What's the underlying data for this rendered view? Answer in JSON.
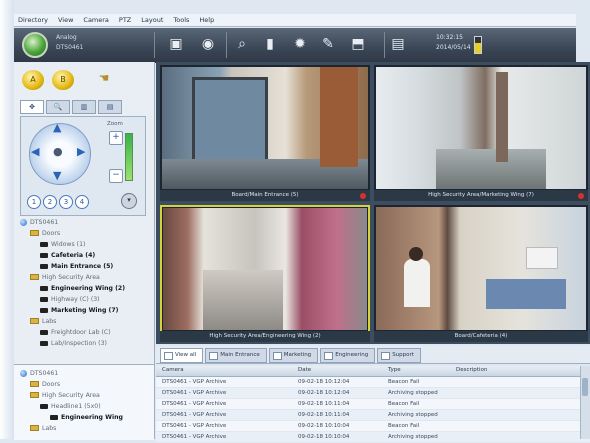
{
  "menu": [
    "Directory",
    "View",
    "Camera",
    "PTZ",
    "Layout",
    "Tools",
    "Help"
  ],
  "header": {
    "site_line1": "Analog",
    "site_line2": "DTS0461",
    "clock_time": "10:32:15",
    "clock_date": "2014/05/14",
    "battery_level": 0.6
  },
  "toolbar_icons": [
    "camera-snapshot-icon",
    "record-icon",
    "zoom-search-icon",
    "remote-icon",
    "settings-gear-icon",
    "edit-icon",
    "export-icon",
    "layout-icon"
  ],
  "left_panel": {
    "quick_buttons": [
      "A",
      "B"
    ],
    "tabs": [
      "✥",
      "🔍",
      "▥",
      "▤"
    ],
    "presets": [
      "1",
      "2",
      "3",
      "4"
    ],
    "ptz_label": "Zoom"
  },
  "tree": [
    {
      "label": "DTS0461",
      "level": 0,
      "icon": "globe",
      "bold": false
    },
    {
      "label": "Doors",
      "level": 1,
      "icon": "folder",
      "bold": false
    },
    {
      "label": "Widows (1)",
      "level": 2,
      "icon": "camera",
      "bold": false
    },
    {
      "label": "Cafeteria (4)",
      "level": 2,
      "icon": "camera",
      "bold": true
    },
    {
      "label": "Main Entrance (5)",
      "level": 2,
      "icon": "camera",
      "bold": true
    },
    {
      "label": "High Security Area",
      "level": 1,
      "icon": "folder",
      "bold": false
    },
    {
      "label": "Engineering Wing (2)",
      "level": 2,
      "icon": "camera",
      "bold": true
    },
    {
      "label": "Highway (C) (3)",
      "level": 2,
      "icon": "camera",
      "bold": false
    },
    {
      "label": "Marketing Wing (7)",
      "level": 2,
      "icon": "camera",
      "bold": true
    },
    {
      "label": "Labs",
      "level": 1,
      "icon": "folder",
      "bold": false
    },
    {
      "label": "Freightdoor Lab (C)",
      "level": 2,
      "icon": "camera",
      "bold": false
    },
    {
      "label": "Lab/Inspection (3)",
      "level": 2,
      "icon": "camera",
      "bold": false
    }
  ],
  "tree2": [
    {
      "label": "DTS0461",
      "level": 0,
      "icon": "globe",
      "bold": false
    },
    {
      "label": "Doors",
      "level": 1,
      "icon": "folder",
      "bold": false
    },
    {
      "label": "High Security Area",
      "level": 1,
      "icon": "folder",
      "bold": false
    },
    {
      "label": "Headline1 (5x0)",
      "level": 2,
      "icon": "camera",
      "bold": false
    },
    {
      "label": "Engineering Wing",
      "level": 3,
      "icon": "camera",
      "bold": true
    },
    {
      "label": "Labs",
      "level": 1,
      "icon": "folder",
      "bold": false
    }
  ],
  "video": [
    {
      "caption": "Board/Main Entrance (5)",
      "rec": true,
      "selected": false
    },
    {
      "caption": "High Security Area/Marketing Wing (7)",
      "rec": true,
      "selected": false
    },
    {
      "caption": "High Security Area/Engineering Wing (2)",
      "rec": false,
      "selected": true
    },
    {
      "caption": "Board/Cafeteria (4)",
      "rec": false,
      "selected": false
    }
  ],
  "bottom_tabs": [
    "View all",
    "Main Entrance",
    "Marketing",
    "Engineering",
    "Support"
  ],
  "log": {
    "headers": [
      "Camera",
      "Date",
      "Type",
      "Description"
    ],
    "rows": [
      [
        "DTS0461 - VGP Archive",
        "09-02-18 10:12:04",
        "Beacon Fail",
        ""
      ],
      [
        "DTS0461 - VGP Archive",
        "09-02-18 10:12:04",
        "Archiving stopped",
        ""
      ],
      [
        "DTS0461 - VGP Archive",
        "09-02-18 10:11:04",
        "Beacon Fail",
        ""
      ],
      [
        "DTS0461 - VGP Archive",
        "09-02-18 10:11:04",
        "Archiving stopped",
        ""
      ],
      [
        "DTS0461 - VGP Archive",
        "09-02-18 10:10:04",
        "Beacon Fail",
        ""
      ],
      [
        "DTS0461 - VGP Archive",
        "09-02-18 10:10:04",
        "Archiving stopped",
        ""
      ]
    ]
  }
}
